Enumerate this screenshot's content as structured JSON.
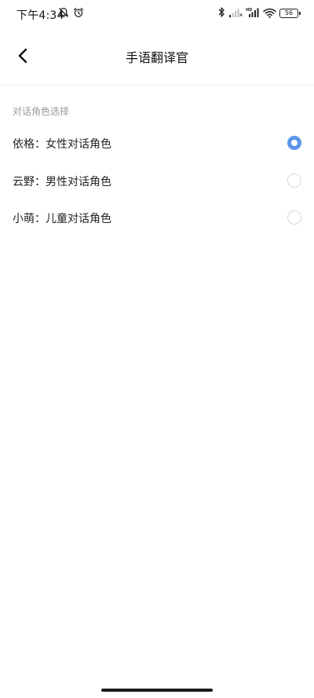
{
  "status_bar": {
    "time": "下午4:34",
    "battery_level": "56",
    "icons": [
      "mute-icon",
      "alarm-icon",
      "bluetooth-icon",
      "signal-1-icon",
      "hd-signal-2-icon",
      "wifi-icon",
      "battery-icon"
    ]
  },
  "nav": {
    "title": "手语翻译官",
    "back_icon": "chevron-left-icon"
  },
  "section": {
    "header": "对话角色选择",
    "options": [
      {
        "label": "依格：女性对话角色",
        "selected": true
      },
      {
        "label": "云野：男性对话角色",
        "selected": false
      },
      {
        "label": "小萌：儿童对话角色",
        "selected": false
      }
    ]
  },
  "colors": {
    "accent": "#5b96e8",
    "radio_border": "#d9d9d9",
    "section_header": "#9a9a9a",
    "divider": "#ececec"
  }
}
